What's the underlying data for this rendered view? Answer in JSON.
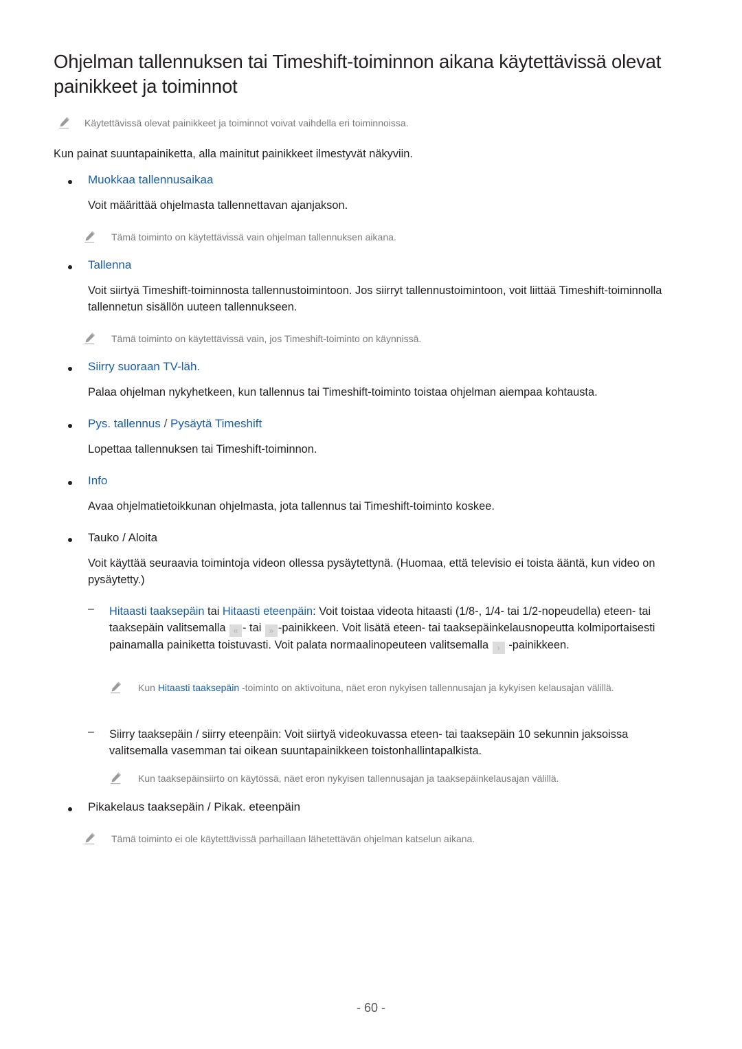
{
  "title": "Ohjelman tallennuksen tai Timeshift-toiminnon aikana käytettävissä olevat painikkeet ja toiminnot",
  "intro_note": "Käytettävissä olevat painikkeet ja toiminnot voivat vaihdella eri toiminnoissa.",
  "intro": "Kun painat suuntapainiketta, alla mainitut painikkeet ilmestyvät näkyviin.",
  "items": [
    {
      "heading": "Muokkaa tallennusaikaa",
      "text": "Voit määrittää ohjelmasta tallennettavan ajanjakson.",
      "note": "Tämä toiminto on käytettävissä vain ohjelman tallennuksen aikana."
    },
    {
      "heading": "Tallenna",
      "text": "Voit siirtyä Timeshift-toiminnosta tallennustoimintoon. Jos siirryt tallennustoimintoon, voit liittää Timeshift-toiminnolla tallennetun sisällön uuteen tallennukseen.",
      "note": "Tämä toiminto on käytettävissä vain, jos Timeshift-toiminto on käynnissä."
    },
    {
      "heading": "Siirry suoraan TV-läh.",
      "text": "Palaa ohjelman nykyhetkeen, kun tallennus tai Timeshift-toiminto toistaa ohjelman aiempaa kohtausta."
    },
    {
      "heading_a": "Pys. tallennus",
      "heading_sep": " / ",
      "heading_b": "Pysäytä Timeshift",
      "text": "Lopettaa tallennuksen tai Timeshift-toiminnon."
    },
    {
      "heading": "Info",
      "text": "Avaa ohjelmatietoikkunan ohjelmasta, jota tallennus tai Timeshift-toiminto koskee."
    },
    {
      "heading": "Tauko / Aloita",
      "text": "Voit käyttää seuraavia toimintoja videon ollessa pysäytettynä. (Huomaa, että televisio ei toista ääntä, kun video on pysäytetty.)",
      "sub": [
        {
          "term_a": "Hitaasti taaksepäin",
          "joiner": " tai ",
          "term_b": "Hitaasti eteenpäin",
          "text_1": ": Voit toistaa videota hitaasti (1/8-, 1/4- tai 1/2-nopeudella) eteen- tai taaksepäin valitsemalla ",
          "key_rew": "«",
          "text_2": "- tai ",
          "key_ff": "»",
          "text_3": "-painikkeen. Voit lisätä eteen- tai taaksepäinkelausnopeutta kolmiportaisesti painamalla painiketta toistuvasti. Voit palata normaalinopeuteen valitsemalla ",
          "key_play": "›",
          "text_4": " -painikkeen.",
          "note_pre": "Kun ",
          "note_term": "Hitaasti taaksepäin",
          "note_post": " -toiminto on aktivoituna, näet eron nykyisen tallennusajan ja kykyisen kelausajan välillä."
        },
        {
          "text": "Siirry taaksepäin / siirry eteenpäin: Voit siirtyä videokuvassa eteen- tai taaksepäin 10 sekunnin jaksoissa valitsemalla vasemman tai oikean suuntapainikkeen toistonhallintapalkista.",
          "note": "Kun taaksepäinsiirto on käytössä, näet eron nykyisen tallennusajan ja taaksepäinkelausajan välillä."
        }
      ]
    },
    {
      "heading": "Pikakelaus taaksepäin / Pikak. eteenpäin",
      "note": "Tämä toiminto ei ole käytettävissä parhaillaan lähetettävän ohjelman katselun aikana."
    }
  ],
  "page_number": "- 60 -",
  "colors": {
    "accent": "#1a5ea6",
    "text": "#231f20",
    "note": "#7a7a7a"
  }
}
